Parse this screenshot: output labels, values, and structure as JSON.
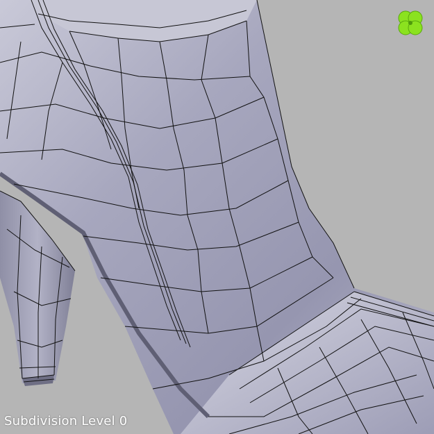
{
  "viewport": {
    "overlay_label": "Subdivision Level 0",
    "background_color": "#b5b5b5",
    "mesh_fill_color": "#a6a6bd",
    "wire_color": "#111111"
  },
  "logo": {
    "icon": "four-leaf-clover-icon",
    "color": "#8be21f"
  },
  "model": {
    "description_icon": "high-heel-boot-mesh"
  }
}
